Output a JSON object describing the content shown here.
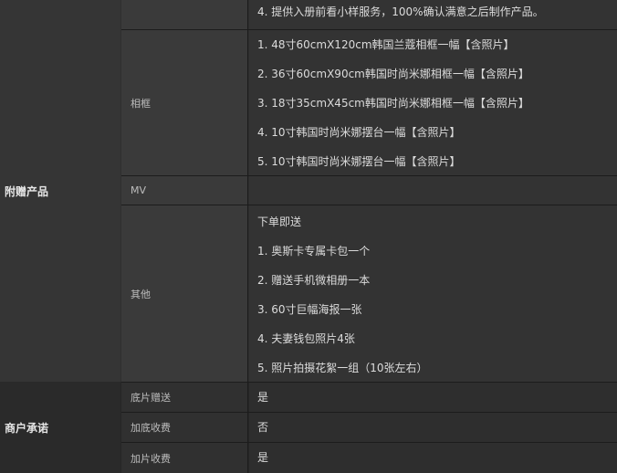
{
  "gift_section": {
    "category": "附赠产品",
    "top_row": {
      "label": "",
      "lines": [
        "4. 提供入册前看小样服务，100%确认满意之后制作产品。"
      ]
    },
    "frame_row": {
      "label": "相框",
      "lines": [
        "1.  48寸60cmX120cm韩国兰蔻相框一幅【含照片】",
        "2.  36寸60cmX90cm韩国时尚米娜相框一幅【含照片】",
        "3. 18寸35cmX45cm韩国时尚米娜相框一幅【含照片】",
        "4.  10寸韩国时尚米娜摆台一幅【含照片】",
        "5.  10寸韩国时尚米娜摆台一幅【含照片】"
      ]
    },
    "mv_row": {
      "label": "MV",
      "lines": []
    },
    "other_row": {
      "label": "其他",
      "lines": [
        "下单即送",
        "1. 奥斯卡专属卡包一个",
        "2. 赠送手机微相册一本",
        "3. 60寸巨幅海报一张",
        "4. 夫妻钱包照片4张",
        "5. 照片拍摄花絮一组（10张左右）"
      ]
    }
  },
  "promise_section": {
    "category": "商户承诺",
    "rows": [
      {
        "label": "底片赠送",
        "value": "是"
      },
      {
        "label": "加底收费",
        "value": "否"
      },
      {
        "label": "加片收费",
        "value": "是"
      }
    ]
  }
}
